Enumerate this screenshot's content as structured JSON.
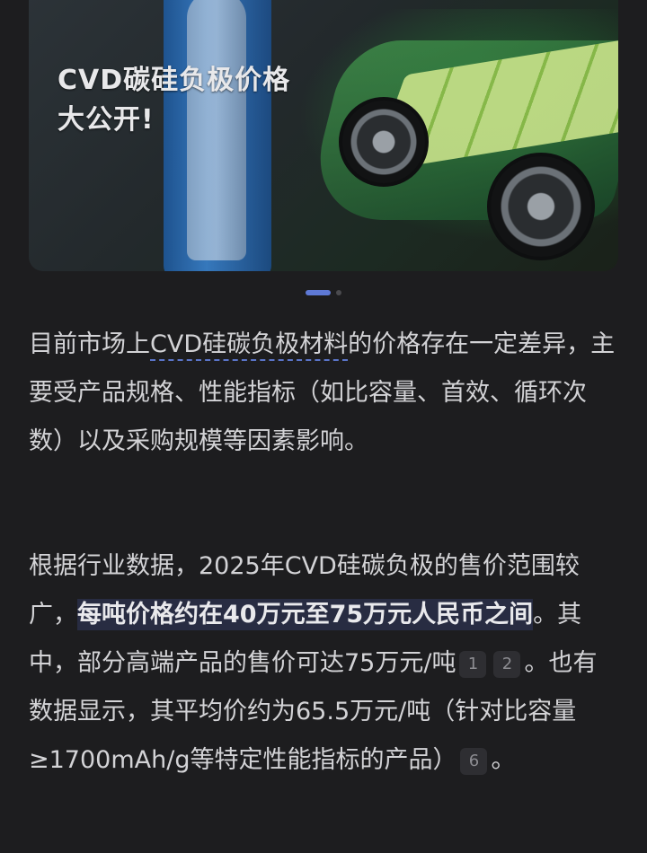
{
  "hero": {
    "title_line1": "CVD碳硅负极价格",
    "title_line2": "大公开!"
  },
  "carousel": {
    "active_index": 1,
    "total": 2
  },
  "paragraph1": {
    "prefix": "目前市场上",
    "link_text": "CVD硅碳负极材料",
    "suffix": "的价格存在一定差异，主要受产品规格、性能指标（如比容量、首效、循环次数）以及采购规模等因素影响。"
  },
  "paragraph2": {
    "part1": "根据行业数据，2025年CVD硅碳负极的售价范围较广，",
    "highlight": "每吨价格约在40万元至75万元人民币之间",
    "part2": "。其中，部分高端产品的售价可达75万元/吨",
    "cite1": "1",
    "cite2": "2",
    "part3": "。也有数据显示，其平均价约为65.5万元/吨（针对比容量≥1700mAh/g等特定性能指标的产品）",
    "cite3": "6",
    "part4": "。"
  },
  "colors": {
    "background": "#1d1d1f",
    "accent": "#5e79d6",
    "text": "#d3d3d6"
  }
}
